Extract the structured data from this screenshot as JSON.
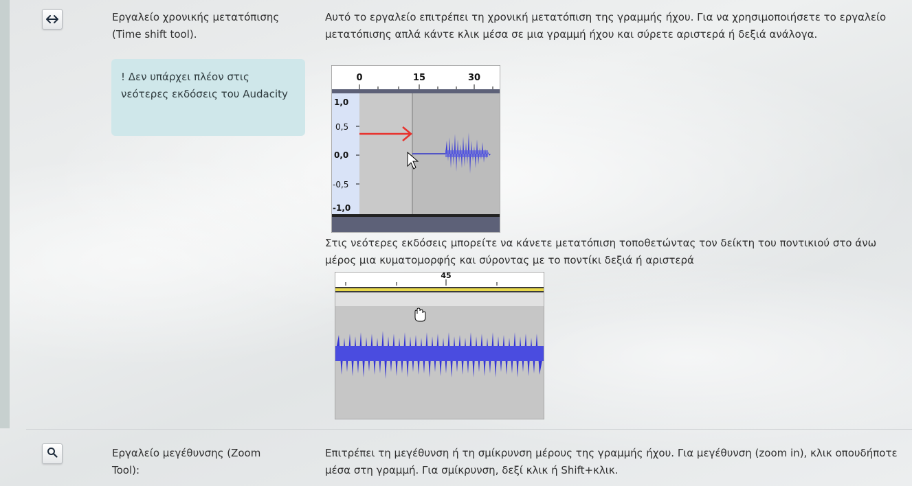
{
  "rows": [
    {
      "icon": "left-right-arrow-icon",
      "icon_glyph": "↔",
      "name": "Εργαλείο χρονικής μετατόπισης (Time shift tool).",
      "description": "Αυτό το εργαλείο επιτρέπει τη χρονική μετατόπιση της γραμμής ήχου. Για να χρησιμοποιήσετε το εργαλείο μετατόπισης απλά κάντε κλικ μέσα σε μια γραμμή ήχου και σύρετε αριστερά ή δεξιά ανάλογα.",
      "note": "! Δεν υπάρχει πλέον στις νεότερες εκδόσεις του Audacity",
      "description2": "Στις νεότερες εκδόσεις μπορείτε να κάνετε μετατόπιση τοποθετώντας τον δείκτη του ποντικιού στο άνω μέρος μια κυματομορφής και σύροντας με το ποντίκι δεξιά ή αριστερά",
      "image1": {
        "ruler_labels": [
          "0",
          "15",
          "30"
        ],
        "scale_labels": [
          "1,0",
          "0,5",
          "0,0",
          "-0,5",
          "-1,0"
        ],
        "arrow_color": "#e8322d",
        "wave_color": "#3a3cd4"
      },
      "image2": {
        "ruler_label": "45",
        "wave_color": "#3a3cd4"
      }
    },
    {
      "icon": "magnifier-icon",
      "icon_glyph": "🔍",
      "name": "Εργαλείο μεγέθυνσης (Zoom Tool):",
      "description": "Επιτρέπει τη μεγέθυνση ή τη σμίκρυνση μέρους της γραμμής ήχου. Για μεγέθυνση (zoom  in), κλικ οπουδήποτε μέσα στη γραμμή. Για σμίκρυνση, δεξί κλικ ή Shift+κλικ."
    }
  ]
}
